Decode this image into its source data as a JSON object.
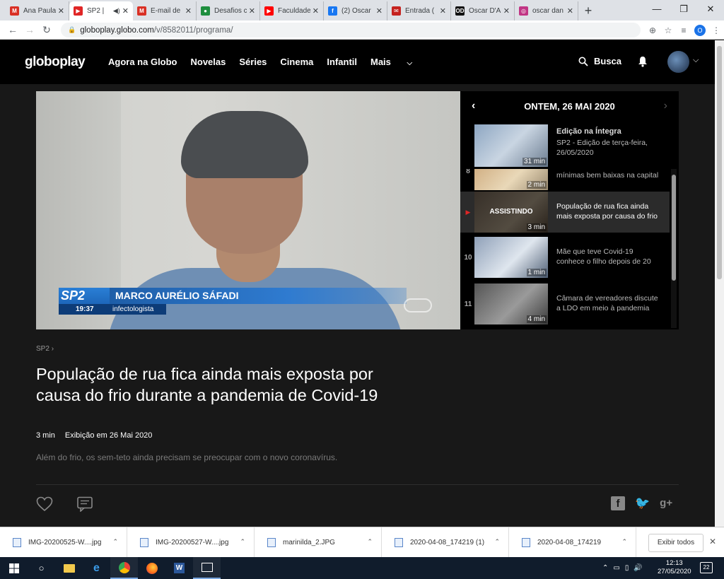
{
  "tabs": [
    {
      "title": "Ana Paula",
      "favicon": "gmail-icon",
      "color": "#d93025",
      "glyph": "M"
    },
    {
      "title": "SP2 |",
      "favicon": "globoplay-icon",
      "color": "#e02626",
      "glyph": "▶",
      "active": true
    },
    {
      "title": "E-mail de",
      "favicon": "gmail-icon",
      "color": "#d93025",
      "glyph": "M"
    },
    {
      "title": "Desafios c",
      "favicon": "green-circle-icon",
      "color": "#1e8e3e",
      "glyph": "●"
    },
    {
      "title": "Faculdade",
      "favicon": "youtube-icon",
      "color": "#ff0000",
      "glyph": "▶"
    },
    {
      "title": "(2) Oscar",
      "favicon": "facebook-icon",
      "color": "#1877f2",
      "glyph": "f"
    },
    {
      "title": "Entrada (",
      "favicon": "mail-icon",
      "color": "#c5221f",
      "glyph": "✉"
    },
    {
      "title": "Oscar D'A",
      "favicon": "od-icon",
      "color": "#111111",
      "glyph": "OD"
    },
    {
      "title": "oscar dan",
      "favicon": "instagram-icon",
      "color": "#c13584",
      "glyph": "◎"
    }
  ],
  "address": {
    "host": "globoplay.globo.com",
    "path": "/v/8582011/programa/"
  },
  "profile_initial": "O",
  "site": {
    "logo": "globoplay",
    "nav": [
      "Agora na Globo",
      "Novelas",
      "Séries",
      "Cinema",
      "Infantil",
      "Mais"
    ],
    "search_label": "Busca"
  },
  "player": {
    "bug": "SP2",
    "time": "19:37",
    "name": "MARCO AURÉLIO SÁFADI",
    "job": "infectologista"
  },
  "playlist": {
    "date": "ONTEM, 26 MAI 2020",
    "featured": {
      "title": "Edição na Íntegra",
      "subtitle": "SP2 - Edição de terça-feira, 26/05/2020",
      "duration": "31 min"
    },
    "items": [
      {
        "num": "8",
        "text": "mínimas bem baixas na capital",
        "duration": "2 min",
        "top": 0
      },
      {
        "num": "▶",
        "text": "População de rua fica ainda mais exposta por causa do frio",
        "duration": "3 min",
        "watching": "ASSISTINDO",
        "active": true
      },
      {
        "num": "10",
        "text": "Mãe que teve Covid-19 conhece o filho depois de 20",
        "duration": "1 min"
      },
      {
        "num": "11",
        "text": "Câmara de vereadores discute a LDO em meio à pandemia",
        "duration": "4 min"
      }
    ]
  },
  "info": {
    "breadcrumb": "SP2",
    "title": "População de rua fica ainda mais exposta por causa do frio durante a pandemia de Covid-19",
    "duration": "3 min",
    "aired": "Exibição em 26 Mai 2020",
    "description": "Além do frio, os sem-teto ainda precisam se preocupar com o novo coronavírus."
  },
  "downloads": [
    "IMG-20200525-W....jpg",
    "IMG-20200527-W....jpg",
    "marinilda_2.JPG",
    "2020-04-08_174219 (1)",
    "2020-04-08_174219"
  ],
  "show_all": "Exibir todos",
  "clock": {
    "time": "12:13",
    "date": "27/05/2020"
  },
  "notifications": "22"
}
